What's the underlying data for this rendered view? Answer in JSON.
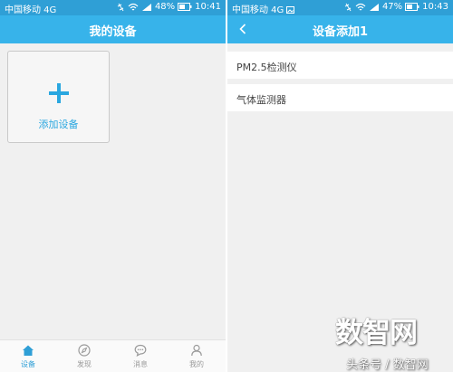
{
  "left_screen": {
    "status_bar": {
      "carrier": "中国移动 4G",
      "battery": "48%",
      "time": "10:41"
    },
    "header": {
      "title": "我的设备"
    },
    "add_device": {
      "label": "添加设备"
    },
    "tab_bar": {
      "tabs": [
        {
          "label": "设备",
          "icon": "home-icon",
          "active": true
        },
        {
          "label": "发现",
          "icon": "compass-icon",
          "active": false
        },
        {
          "label": "消息",
          "icon": "chat-icon",
          "active": false
        },
        {
          "label": "我的",
          "icon": "user-icon",
          "active": false
        }
      ]
    }
  },
  "right_screen": {
    "status_bar": {
      "carrier": "中国移动 4G",
      "battery": "47%",
      "time": "10:43"
    },
    "header": {
      "title": "设备添加1"
    },
    "list": [
      {
        "label": "PM2.5检测仪"
      },
      {
        "label": "气体监测器"
      }
    ]
  },
  "watermark": {
    "logo": "数智网",
    "source": "头条号 / 数智网"
  },
  "colors": {
    "status_bar": "#2f9fd6",
    "header": "#37b3ea",
    "accent": "#2aa7e0",
    "background": "#f0f0f0"
  }
}
